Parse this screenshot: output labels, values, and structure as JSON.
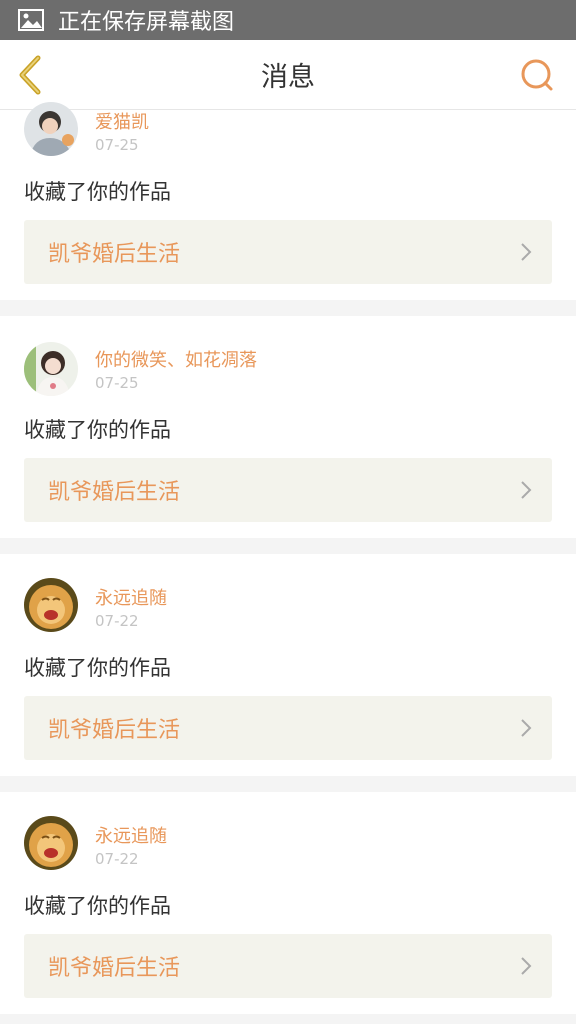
{
  "status_bar": {
    "text": "正在保存屏幕截图",
    "icon": "image-icon"
  },
  "header": {
    "title": "消息",
    "back_icon": "back-chevron-icon",
    "search_icon": "search-icon",
    "accent_color": "#e8975a",
    "back_color": "#c9a227"
  },
  "messages": [
    {
      "user": "爱猫凯",
      "date": "07-25",
      "action": "收藏了你的作品",
      "work_title": "凯爷婚后生活",
      "avatar": "avatar-boy-photo"
    },
    {
      "user": "你的微笑、如花凋落",
      "date": "07-25",
      "action": "收藏了你的作品",
      "work_title": "凯爷婚后生活",
      "avatar": "avatar-girl-photo"
    },
    {
      "user": "永远追随",
      "date": "07-22",
      "action": "收藏了你的作品",
      "work_title": "凯爷婚后生活",
      "avatar": "avatar-cat-photo"
    },
    {
      "user": "永远追随",
      "date": "07-22",
      "action": "收藏了你的作品",
      "work_title": "凯爷婚后生活",
      "avatar": "avatar-cat-photo"
    }
  ]
}
